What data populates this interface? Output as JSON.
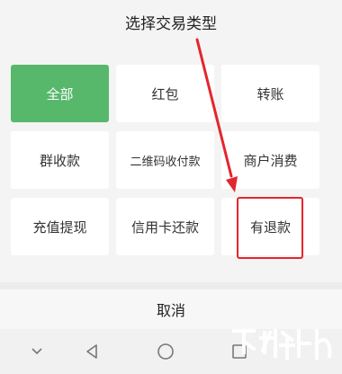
{
  "dialog": {
    "title": "选择交易类型",
    "tiles": [
      {
        "label": "全部",
        "name": "tile-all",
        "selected": true
      },
      {
        "label": "红包",
        "name": "tile-red-packet",
        "selected": false
      },
      {
        "label": "转账",
        "name": "tile-transfer",
        "selected": false
      },
      {
        "label": "群收款",
        "name": "tile-group-collection",
        "selected": false
      },
      {
        "label": "二维码收付款",
        "name": "tile-qr-payment",
        "selected": false
      },
      {
        "label": "商户消费",
        "name": "tile-merchant-purchase",
        "selected": false
      },
      {
        "label": "充值提现",
        "name": "tile-topup-withdraw",
        "selected": false
      },
      {
        "label": "信用卡还款",
        "name": "tile-credit-card-repayment",
        "selected": false
      },
      {
        "label": "有退款",
        "name": "tile-refunded",
        "selected": false
      }
    ],
    "cancel_label": "取消"
  },
  "navigation_bar": {
    "icons": [
      "chevron-down-icon",
      "back-triangle-icon",
      "home-circle-icon",
      "recents-square-icon"
    ]
  },
  "colors": {
    "accent": "#57b86b",
    "annotation": "#e3262d"
  }
}
